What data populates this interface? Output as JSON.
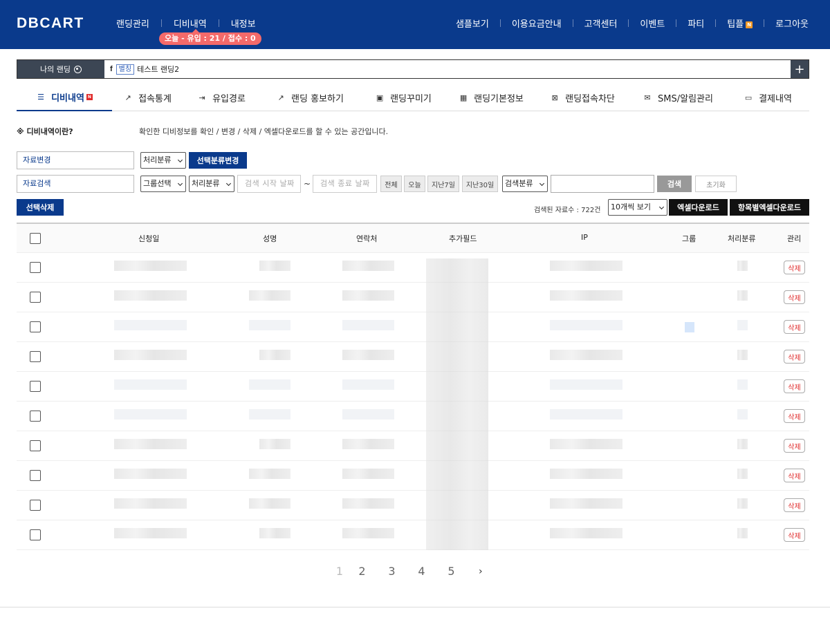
{
  "header": {
    "logo": "DBCART",
    "nav_left": [
      "랜딩관리",
      "디비내역",
      "내정보"
    ],
    "today_badge": "오늘 - 유입 : 21 / 접수 : 0",
    "nav_right": [
      "샘플보기",
      "이용요금안내",
      "고객센터",
      "이벤트",
      "파티",
      "팁플",
      "로그아웃"
    ],
    "new_badge": "N"
  },
  "landing": {
    "label": "나의 랜딩",
    "platform_icon": "f",
    "alias_tag": "별칭",
    "name": "테스트 랜딩2",
    "add_button": "+"
  },
  "tabs": [
    {
      "label": "디비내역",
      "icon": "list-icon",
      "active": true,
      "badge": "N"
    },
    {
      "label": "접속통계",
      "icon": "chart-icon"
    },
    {
      "label": "유입경로",
      "icon": "login-icon"
    },
    {
      "label": "랜딩 홍보하기",
      "icon": "share-icon"
    },
    {
      "label": "랜딩꾸미기",
      "icon": "image-icon"
    },
    {
      "label": "랜딩기본정보",
      "icon": "grid-icon"
    },
    {
      "label": "랜딩접속차단",
      "icon": "block-icon"
    },
    {
      "label": "SMS/알림관리",
      "icon": "mail-icon"
    },
    {
      "label": "결제내역",
      "icon": "card-icon"
    }
  ],
  "description": {
    "title": "※ 디비내역이란?",
    "text": "확인한 디비정보를 확인 / 변경 / 삭제 / 엑셀다운로드를 할 수 있는 공간입니다."
  },
  "controls": {
    "change_label": "자료변경",
    "status_select": "처리분류",
    "change_status_button": "선택분류변경",
    "search_label": "자료검색",
    "group_select": "그룹선택",
    "status_select2": "처리분류",
    "date_start_placeholder": "검색 시작 날짜",
    "tilde": "~",
    "date_end_placeholder": "검색 종료 날짜",
    "quick_ranges": [
      "전체",
      "오늘",
      "지난7일",
      "지난30일"
    ],
    "search_category": "검색분류",
    "search_button": "검색",
    "reset_button": "초기화",
    "delete_selected_button": "선택삭제",
    "result_count": "검색된 자료수 : 722건",
    "page_size_select": "10개씩 보기",
    "excel_button": "엑셀다운로드",
    "excel_by_field_button": "항목별엑셀다운로드"
  },
  "table": {
    "columns": [
      "신청일",
      "성명",
      "연락처",
      "추가필드",
      "IP",
      "그룹",
      "처리분류",
      "관리"
    ],
    "row_count": 10,
    "delete_label": "삭제"
  },
  "pagination": {
    "pages": [
      "1",
      "2",
      "3",
      "4",
      "5"
    ],
    "current": "1",
    "next": "›"
  }
}
